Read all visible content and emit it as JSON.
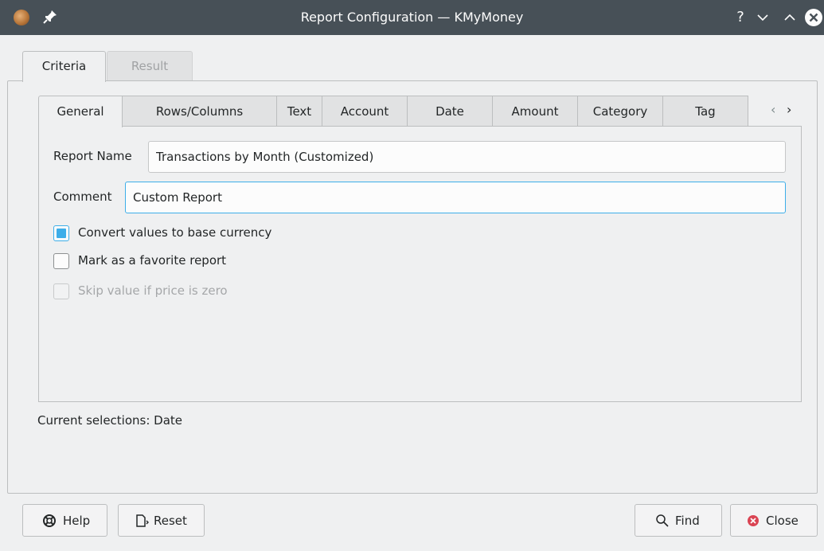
{
  "window": {
    "title": "Report Configuration — KMyMoney",
    "help_glyph": "?"
  },
  "outer_tabs": [
    {
      "label": "Criteria",
      "active": true
    },
    {
      "label": "Result",
      "active": false
    }
  ],
  "inner_tabs": [
    {
      "label": "General",
      "active": true
    },
    {
      "label": "Rows/Columns"
    },
    {
      "label": "Text"
    },
    {
      "label": "Account"
    },
    {
      "label": "Date"
    },
    {
      "label": "Amount"
    },
    {
      "label": "Category"
    },
    {
      "label": "Tag"
    }
  ],
  "tab_scroll": {
    "left": "‹",
    "right": "›"
  },
  "general": {
    "report_name_label": "Report Name",
    "report_name_value": "Transactions by Month (Customized)",
    "comment_label": "Comment",
    "comment_value": "Custom Report",
    "options": [
      {
        "label": "Convert values to base currency",
        "checked": true,
        "enabled": true
      },
      {
        "label": "Mark as a favorite report",
        "checked": false,
        "enabled": true
      },
      {
        "label": "Skip value if price is zero",
        "checked": false,
        "enabled": false
      }
    ]
  },
  "status": {
    "text": "Current selections: Date"
  },
  "buttons": {
    "help": "Help",
    "reset": "Reset",
    "find": "Find",
    "close": "Close"
  },
  "colors": {
    "accent": "#3daee9",
    "titlebar": "#475057",
    "close_icon": "#da4453"
  }
}
